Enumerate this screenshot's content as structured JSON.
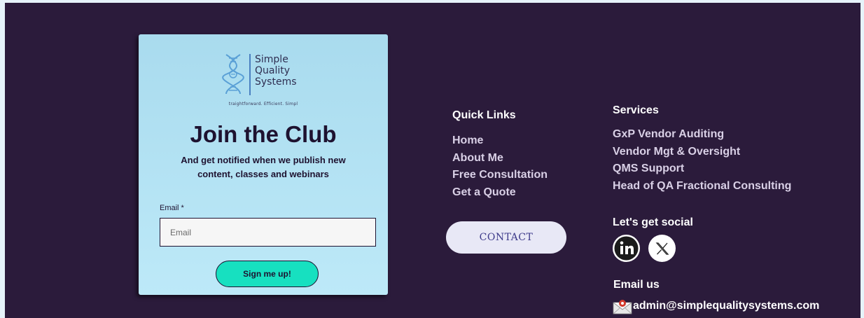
{
  "newsletter": {
    "logo_lines": [
      "Simple",
      "Quality",
      "Systems"
    ],
    "tagline": "traightforward. Efficient. Simpl",
    "title": "Join the Club",
    "subtitle_line1": "And get notified when we publish new",
    "subtitle_line2": "content, classes and webinars",
    "email_label": "Email *",
    "email_placeholder": "Email",
    "email_value": "",
    "signup_label": "Sign me up!"
  },
  "quick_links": {
    "title": "Quick Links",
    "items": [
      "Home",
      "About Me",
      "Free Consultation",
      "Get a Quote"
    ]
  },
  "contact": {
    "label": "CONTACT"
  },
  "services": {
    "title": "Services",
    "items": [
      "GxP Vendor Auditing",
      "Vendor Mgt & Oversight",
      "QMS Support",
      "Head of QA Fractional Consulting"
    ]
  },
  "social": {
    "title": "Let's get social",
    "icons": [
      "linkedin-icon",
      "x-twitter-icon"
    ]
  },
  "email_us": {
    "title": "Email us",
    "address": "admin@simplequalitysystems.com"
  },
  "colors": {
    "footer_bg": "#2b1b3b",
    "card_bg": "#bde9f8",
    "signup_btn": "#17e0c0",
    "contact_btn": "#e8e8f6",
    "link_text": "#d9d0e6"
  }
}
